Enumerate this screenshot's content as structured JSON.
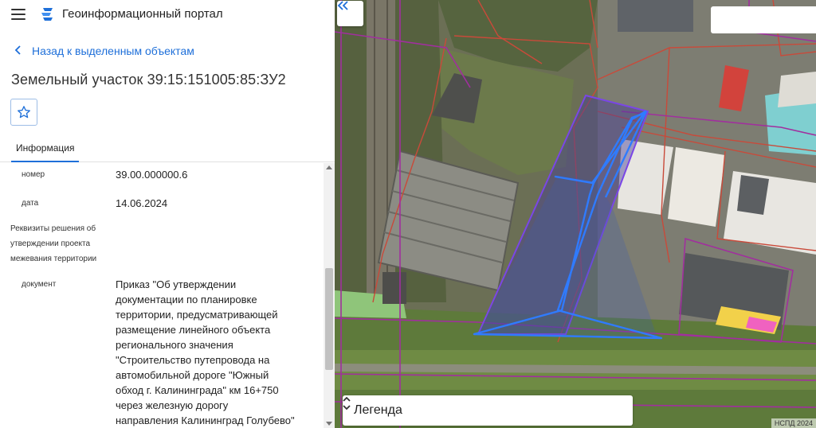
{
  "header": {
    "title": "Геоинформационный портал"
  },
  "nav": {
    "back_label": "Назад к выделенным объектам"
  },
  "object": {
    "title": "Земельный участок 39:15:151005:85:ЗУ2"
  },
  "tabs": [
    {
      "label": "Информация",
      "active": true
    }
  ],
  "info": {
    "rows": [
      {
        "label": "номер",
        "value": "39.00.000000.6"
      },
      {
        "label": "дата",
        "value": "14.06.2024"
      }
    ],
    "section": {
      "lines": [
        "Реквизиты решения об",
        "утверждении проекта",
        "межевания территории"
      ]
    },
    "document": {
      "label": "документ",
      "lines": [
        "Приказ \"Об утверждении",
        "документации по планировке",
        "территории, предусматривающей",
        "размещение линейного объекта",
        "регионального значения",
        "\"Строительство путепровода на",
        "автомобильной дороге \"Южный",
        "обход г. Калининграда\" км 16+750",
        "через железную дорогу",
        "направления Калининград Голубево\""
      ]
    }
  },
  "map": {
    "legend_label": "Легенда",
    "attribution": "НСПД 2024",
    "search_value": ""
  },
  "colors": {
    "accent": "#1e6fd9",
    "parcel_outline": "#2f7bff",
    "boundary_red": "#c94a3a",
    "boundary_purple": "#a12f9e"
  }
}
